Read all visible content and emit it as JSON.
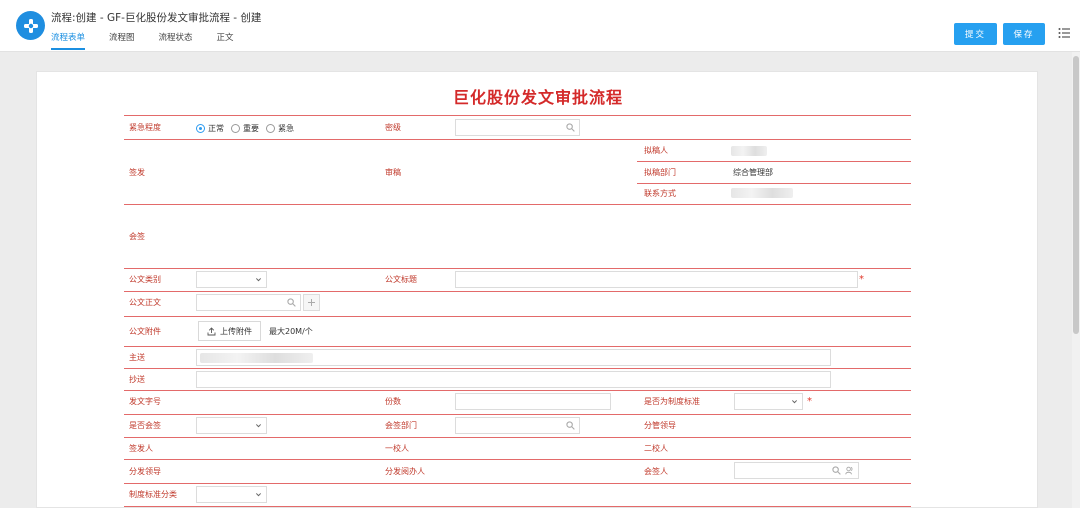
{
  "header": {
    "title": "流程:创建 - GF-巨化股份发文审批流程 - 创建",
    "tabs": [
      "流程表单",
      "流程图",
      "流程状态",
      "正文"
    ],
    "submit_label": "提交",
    "save_label": "保存"
  },
  "form": {
    "title": "巨化股份发文审批流程",
    "urgency": {
      "label": "紧急程度",
      "options": [
        "正常",
        "重要",
        "紧急"
      ],
      "selected": "正常"
    },
    "secret_level_label": "密级",
    "issue_label": "签发",
    "review_label": "审稿",
    "drafter_label": "拟稿人",
    "draft_dept_label": "拟稿部门",
    "draft_dept_value": "综合管理部",
    "contact_label": "联系方式",
    "countersign_label": "会签",
    "doc_category_label": "公文类别",
    "doc_title_label": "公文标题",
    "doc_body_label": "公文正文",
    "doc_attach_label": "公文附件",
    "upload_label": "上传附件",
    "upload_limit": "最大20M/个",
    "main_send_label": "主送",
    "cc_label": "抄送",
    "doc_number_label": "发文字号",
    "copies_label": "份数",
    "is_standard_label": "是否为制度标准",
    "need_countersign_label": "是否会签",
    "countersign_dept_label": "会签部门",
    "leader_label": "分管领导",
    "issuer_label": "签发人",
    "first_proof_label": "一校人",
    "second_proof_label": "二校人",
    "distrib_leader_label": "分发领导",
    "distrib_reader_label": "分发阅办人",
    "countersigner_label": "会签人",
    "standard_category_label": "制度标准分类",
    "required_mark": "*"
  },
  "colors": {
    "accent": "#1b8fe1",
    "button": "#26a0f0",
    "form_title": "#d42a2a",
    "label": "#c0392b",
    "line": "#e36a6a"
  }
}
